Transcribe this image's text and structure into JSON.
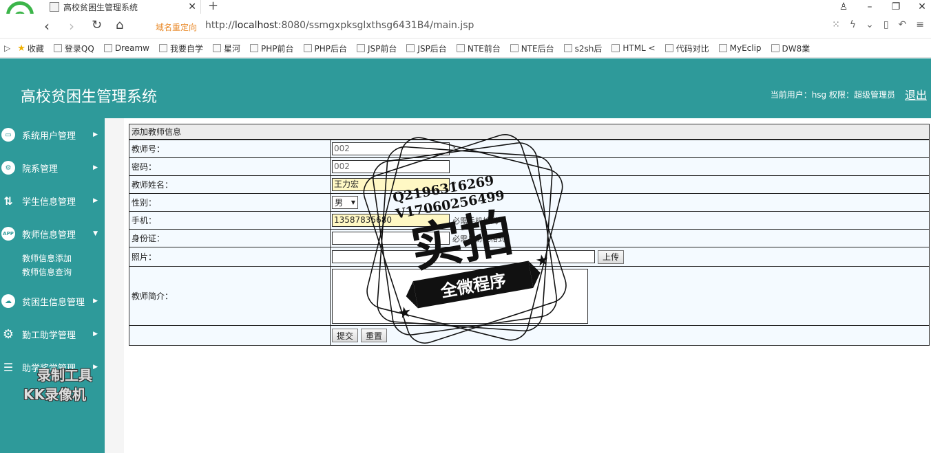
{
  "browser": {
    "tab_title": "高校贫困生管理系统",
    "redirect_label": "域名重定向",
    "url_prefix": "http://",
    "url_host": "localhost",
    "url_rest": ":8080/ssmgxpksglxthsg6431B4/main.jsp"
  },
  "bookmarks": [
    "收藏",
    "登录QQ",
    "Dreamw",
    "我要自学",
    "星河",
    "PHP前台",
    "PHP后台",
    "JSP前台",
    "JSP后台",
    "NTE前台",
    "NTE后台",
    "s2sh后",
    "HTML <",
    "代码对比",
    "MyEclip",
    "DW8業"
  ],
  "header": {
    "title": "高校贫困生管理系统",
    "user_info": "当前用户：hsg  权限：超级管理员",
    "logout": "退出"
  },
  "sidebar": {
    "items": [
      {
        "label": "系统用户管理",
        "icon": "monitor-icon"
      },
      {
        "label": "院系管理",
        "icon": "users-gear-icon"
      },
      {
        "label": "学生信息管理",
        "icon": "route-icon"
      },
      {
        "label": "教师信息管理",
        "icon": "app-icon"
      },
      {
        "label": "贫困生信息管理",
        "icon": "cloud-icon"
      },
      {
        "label": "勤工助学管理",
        "icon": "gear-icon"
      },
      {
        "label": "助学奖学管理",
        "icon": "stack-icon"
      }
    ],
    "sub_items": [
      "教师信息添加",
      "教师信息查询"
    ],
    "app_icon_text": "APP"
  },
  "form": {
    "heading": "添加教师信息",
    "fields": {
      "teacher_no": {
        "label": "教师号：",
        "value": "002",
        "required": "*"
      },
      "password": {
        "label": "密码：",
        "value": "002"
      },
      "name": {
        "label": "教师姓名：",
        "value": "王力宏",
        "required": "*"
      },
      "gender": {
        "label": "性别：",
        "value": "男"
      },
      "phone": {
        "label": "手机：",
        "value": "13587835680",
        "note": "必需手机格式"
      },
      "id_card": {
        "label": "身份证：",
        "value": "",
        "note": "必需身份证格式"
      },
      "photo": {
        "label": "照片：",
        "value": "",
        "upload": "上传"
      },
      "intro": {
        "label": "教师简介：",
        "value": ""
      }
    },
    "submit": "提交",
    "reset": "重置"
  },
  "watermark": {
    "line1": "Q2196316269",
    "line2": "V17060256499",
    "big": "实拍",
    "banner": "全微程序",
    "recorder_line1": "录制工具",
    "recorder_line2": "KK录像机"
  },
  "colors": {
    "teal": "#2e9a9a",
    "redirect": "#e98a2a",
    "highlight": "#fff8c4"
  }
}
